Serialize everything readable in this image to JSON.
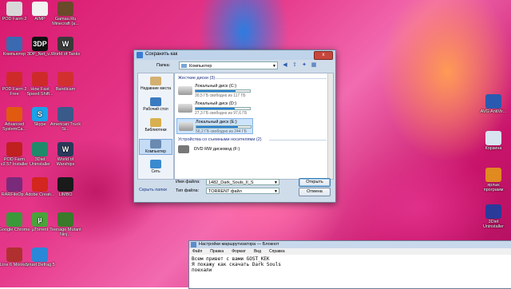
{
  "desktop": {
    "left_icons": [
      {
        "label": "POD Farm 2",
        "icon": "pod-farm-icon",
        "color": "#d8d8d8"
      },
      {
        "label": "Компьютер",
        "icon": "computer-icon",
        "color": "#3a6ab0"
      },
      {
        "label": "POD Farm 2 Free",
        "icon": "pod-farm-icon",
        "color": "#cf2a2a"
      },
      {
        "label": "Advanced SystemCa...",
        "icon": "advanced-systemcare-icon",
        "color": "#e05a10"
      },
      {
        "label": "POD Farm v2.57 Installer",
        "icon": "pod-farm-installer-icon",
        "color": "#c02020"
      },
      {
        "label": "RARFileOp...",
        "icon": "rar-icon",
        "color": "#7a2a7a"
      },
      {
        "label": "Google Chrome",
        "icon": "chrome-icon",
        "color": "#3a9a3a"
      },
      {
        "label": "Line 6 Monkey",
        "icon": "line6-monkey-icon",
        "color": "#b03030"
      }
    ],
    "col2_icons": [
      {
        "label": "AIMP",
        "icon": "aimp-icon",
        "color": "#f2f2f2"
      },
      {
        "label": "3DP_Net_v...",
        "icon": "3dp-net-icon",
        "color": "#111111",
        "text": "3DP"
      },
      {
        "label": "How Fast Speed Shift...",
        "icon": "speed-shift-icon",
        "color": "#cf2a2a"
      },
      {
        "label": "Skype",
        "icon": "skype-icon",
        "color": "#1aa3e8",
        "text": "S"
      },
      {
        "label": "3Diet Uninstaller",
        "icon": "uninstaller-icon",
        "color": "#1f8a6a"
      },
      {
        "label": "Adobe Creati...",
        "icon": "adobe-icon",
        "color": "#d2261e"
      },
      {
        "label": "µTorrent",
        "icon": "utorrent-icon",
        "color": "#4aa33a",
        "text": "µ"
      },
      {
        "label": "Smart Defrag 5",
        "icon": "smart-defrag-icon",
        "color": "#2a88d8"
      }
    ],
    "col3_icons": [
      {
        "label": "Gamau.Ru Minecraft (a...",
        "icon": "minecraft-icon",
        "color": "#6a4a2a"
      },
      {
        "label": "World of Tanks",
        "icon": "world-of-tanks-icon",
        "color": "#3a3a3a",
        "text": "W"
      },
      {
        "label": "Bandicam",
        "icon": "bandicam-icon",
        "color": "#d23030"
      },
      {
        "label": "American Truck Si...",
        "icon": "american-truck-icon",
        "color": "#3a5a8a"
      },
      {
        "label": "World of Warships",
        "icon": "world-of-warships-icon",
        "color": "#2a3a5a",
        "text": "W"
      },
      {
        "label": "LIMBO",
        "icon": "limbo-icon",
        "color": "#1a1a1a"
      },
      {
        "label": "Teenage Mutant Ninj...",
        "icon": "tmnt-icon",
        "color": "#3a7a2a"
      }
    ],
    "right_icons": [
      {
        "label": "AVG AntiVir...",
        "icon": "avg-icon",
        "color": "#2a5ab0"
      },
      {
        "label": "Корзина",
        "icon": "recycle-bin-icon",
        "color": "#d8e4f0"
      },
      {
        "label": "ярлык программ",
        "icon": "shortcut-icon",
        "color": "#e08a20"
      },
      {
        "label": "3Diet Uninstaller",
        "icon": "uninstaller-icon",
        "color": "#2a3a9a"
      }
    ]
  },
  "dialog": {
    "title": "Сохранить как",
    "close_label": "x",
    "folder_label": "Папка:",
    "folder_value": "Компьютер",
    "places": [
      {
        "label": "Недавние места",
        "color": "#d4b070"
      },
      {
        "label": "Рабочий стол",
        "color": "#3a7ac0"
      },
      {
        "label": "Библиотеки",
        "color": "#d8b050"
      },
      {
        "label": "Компьютер",
        "color": "#6a8ab0",
        "selected": true
      },
      {
        "label": "Сеть",
        "color": "#3a8ad0"
      }
    ],
    "hdd_group": "Жесткие диски (3)",
    "drives": [
      {
        "name": "Локальный диск (C:)",
        "free": "30,5 ГБ свободно из 117 ГБ",
        "used_fraction": 0.74
      },
      {
        "name": "Локальный диск (D:)",
        "free": "27,3 ГБ свободно из 97,6 ГБ",
        "used_fraction": 0.72
      },
      {
        "name": "Локальный диск (E:)",
        "free": "56,2 ГБ свободно из 244 ГБ",
        "used_fraction": 0.77,
        "selected": true
      }
    ],
    "removable_group": "Устройства со съемными носителями (2)",
    "dvd": "DVD RW дисковод (F:)",
    "filename_label": "Имя файла:",
    "filename_value": "1482_Dark_Souls_II_S",
    "filetype_label": "Тип файла:",
    "filetype_value": "TORRENT файл",
    "save_button": "Открыть",
    "cancel_button": "Отмена",
    "hide_folders": "Скрыть папки"
  },
  "notepad": {
    "title": "Настройки маршрутизатора — Блокнот",
    "menu": [
      "Файл",
      "Правка",
      "Формат",
      "Вид",
      "Справка"
    ],
    "text": "Всем привет с вами GOST_KEK\nЯ покажу как скачать Dark Souls\nпоехали"
  }
}
